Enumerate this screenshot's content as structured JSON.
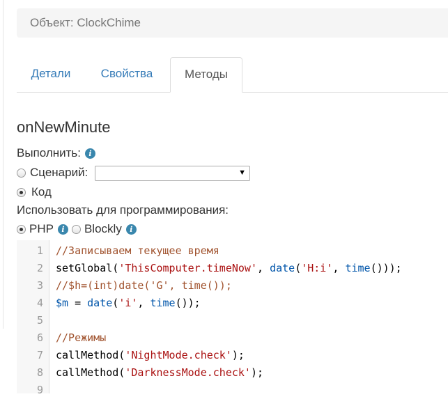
{
  "breadcrumb": "Объект: ClockChime",
  "tabs": [
    {
      "label": "Детали"
    },
    {
      "label": "Свойства"
    },
    {
      "label": "Методы",
      "active": true
    }
  ],
  "method": {
    "title": "onNewMinute",
    "execute_label": "Выполнить:",
    "scenario_label": "Сценарий:",
    "scenario_value": "",
    "code_label": "Код",
    "selected_mode": "code",
    "programming_label": "Использовать для программирования:",
    "php_label": "PHP",
    "blockly_label": "Blockly",
    "selected_language": "php"
  },
  "code_lines": [
    {
      "n": "1",
      "segments": [
        {
          "t": "//Записываем текущее время",
          "c": "comment"
        }
      ]
    },
    {
      "n": "2",
      "segments": [
        {
          "t": "setGlobal(",
          "c": "fn"
        },
        {
          "t": "'ThisComputer.timeNow'",
          "c": "str"
        },
        {
          "t": ", ",
          "c": "fn"
        },
        {
          "t": "date",
          "c": "var"
        },
        {
          "t": "(",
          "c": "fn"
        },
        {
          "t": "'H:i'",
          "c": "str"
        },
        {
          "t": ", ",
          "c": "fn"
        },
        {
          "t": "time",
          "c": "var"
        },
        {
          "t": "()));",
          "c": "fn"
        }
      ]
    },
    {
      "n": "3",
      "segments": [
        {
          "t": "//$h=(int)date('G', time());",
          "c": "comment"
        }
      ]
    },
    {
      "n": "4",
      "segments": [
        {
          "t": "$m",
          "c": "var"
        },
        {
          "t": " = ",
          "c": "fn"
        },
        {
          "t": "date",
          "c": "var"
        },
        {
          "t": "(",
          "c": "fn"
        },
        {
          "t": "'i'",
          "c": "str"
        },
        {
          "t": ", ",
          "c": "fn"
        },
        {
          "t": "time",
          "c": "var"
        },
        {
          "t": "());",
          "c": "fn"
        }
      ]
    },
    {
      "n": "5",
      "segments": []
    },
    {
      "n": "6",
      "segments": [
        {
          "t": "//Режимы",
          "c": "comment"
        }
      ]
    },
    {
      "n": "7",
      "segments": [
        {
          "t": "callMethod(",
          "c": "fn"
        },
        {
          "t": "'NightMode.check'",
          "c": "str"
        },
        {
          "t": ");",
          "c": "fn"
        }
      ]
    },
    {
      "n": "8",
      "segments": [
        {
          "t": "callMethod(",
          "c": "fn"
        },
        {
          "t": "'DarknessMode.check'",
          "c": "str"
        },
        {
          "t": ");",
          "c": "fn"
        }
      ]
    },
    {
      "n": "9",
      "segments": []
    }
  ],
  "icons": {
    "info": "info-icon",
    "dropdown": "chevron-down-icon"
  }
}
